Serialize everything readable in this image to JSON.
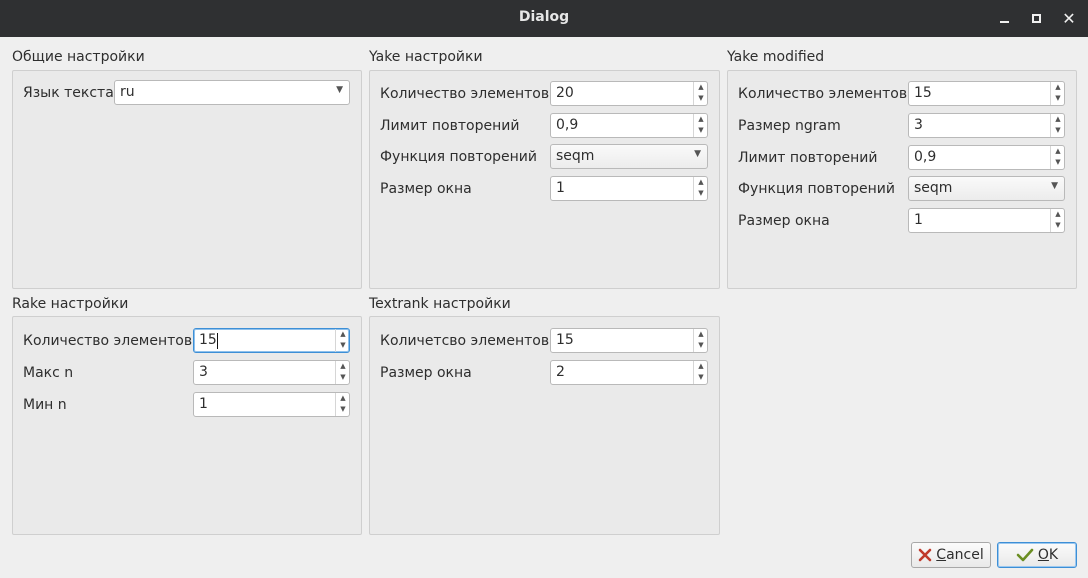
{
  "window": {
    "title": "Dialog"
  },
  "general": {
    "title": "Общие настройки",
    "lang_label": "Язык текста",
    "lang_value": "ru"
  },
  "yake": {
    "title": "Yake настройки",
    "count_label": "Количество элементов",
    "count_value": "20",
    "limit_label": "Лимит повторений",
    "limit_value": "0,9",
    "func_label": "Функция повторений",
    "func_value": "seqm",
    "window_label": "Размер окна",
    "window_value": "1"
  },
  "yake_mod": {
    "title": "Yake modified",
    "count_label": "Количество элементов",
    "count_value": "15",
    "ngram_label": "Размер ngram",
    "ngram_value": "3",
    "limit_label": "Лимит повторений",
    "limit_value": "0,9",
    "func_label": "Функция повторений",
    "func_value": "seqm",
    "window_label": "Размер окна",
    "window_value": "1"
  },
  "rake": {
    "title": "Rake настройки",
    "count_label": "Количество элементов",
    "count_value": "15",
    "maxn_label": "Макс n",
    "maxn_value": "3",
    "minn_label": "Мин n",
    "minn_value": "1"
  },
  "textrank": {
    "title": "Textrank настройки",
    "count_label": "Количетсво элементов",
    "count_value": "15",
    "window_label": "Размер окна",
    "window_value": "2"
  },
  "buttons": {
    "cancel_mnemonic": "C",
    "cancel_rest": "ancel",
    "ok_mnemonic": "O",
    "ok_rest": "K"
  },
  "colors": {
    "titlebar": "#2f3032",
    "focus": "#3d8fd6",
    "cancel_icon": "#c0392b",
    "ok_icon": "#6b8e23"
  },
  "icons": {
    "cancel": "cancel-x-icon",
    "ok": "ok-check-icon"
  }
}
